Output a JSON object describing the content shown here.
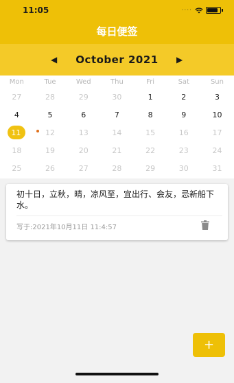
{
  "status_bar": {
    "time": "11:05",
    "signal": "····"
  },
  "nav": {
    "title": "每日便签"
  },
  "calendar": {
    "month_title": "October 2021",
    "weekdays": [
      "Mon",
      "Tue",
      "Wed",
      "Thu",
      "Fri",
      "Sat",
      "Sun"
    ],
    "weeks": [
      [
        {
          "d": "27",
          "s": "muted"
        },
        {
          "d": "28",
          "s": "muted"
        },
        {
          "d": "29",
          "s": "muted"
        },
        {
          "d": "30",
          "s": "muted"
        },
        {
          "d": "1",
          "s": "cur"
        },
        {
          "d": "2",
          "s": "cur"
        },
        {
          "d": "3",
          "s": "cur"
        }
      ],
      [
        {
          "d": "4",
          "s": "cur"
        },
        {
          "d": "5",
          "s": "cur"
        },
        {
          "d": "6",
          "s": "cur"
        },
        {
          "d": "7",
          "s": "cur"
        },
        {
          "d": "8",
          "s": "cur"
        },
        {
          "d": "9",
          "s": "cur"
        },
        {
          "d": "10",
          "s": "cur"
        }
      ],
      [
        {
          "d": "11",
          "s": "today"
        },
        {
          "d": "12",
          "s": "muted"
        },
        {
          "d": "13",
          "s": "muted"
        },
        {
          "d": "14",
          "s": "muted"
        },
        {
          "d": "15",
          "s": "muted"
        },
        {
          "d": "16",
          "s": "muted"
        },
        {
          "d": "17",
          "s": "muted"
        }
      ],
      [
        {
          "d": "18",
          "s": "muted"
        },
        {
          "d": "19",
          "s": "muted"
        },
        {
          "d": "20",
          "s": "muted"
        },
        {
          "d": "21",
          "s": "muted"
        },
        {
          "d": "22",
          "s": "muted"
        },
        {
          "d": "23",
          "s": "muted"
        },
        {
          "d": "24",
          "s": "muted"
        }
      ],
      [
        {
          "d": "25",
          "s": "muted"
        },
        {
          "d": "26",
          "s": "muted"
        },
        {
          "d": "27",
          "s": "muted"
        },
        {
          "d": "28",
          "s": "muted"
        },
        {
          "d": "29",
          "s": "muted"
        },
        {
          "d": "30",
          "s": "muted"
        },
        {
          "d": "31",
          "s": "muted"
        }
      ]
    ]
  },
  "note": {
    "text": "初十日，立秋，晴，凉风至，宜出行、会友，忌新船下水。",
    "timestamp": "写于:2021年10月11日 11:4:57",
    "delete_icon": "trash-icon"
  },
  "fab": {
    "label": "+"
  },
  "colors": {
    "brand": "#eec007",
    "header": "#f4ca28",
    "today": "#f0c212",
    "event_dot": "#e0701b"
  }
}
